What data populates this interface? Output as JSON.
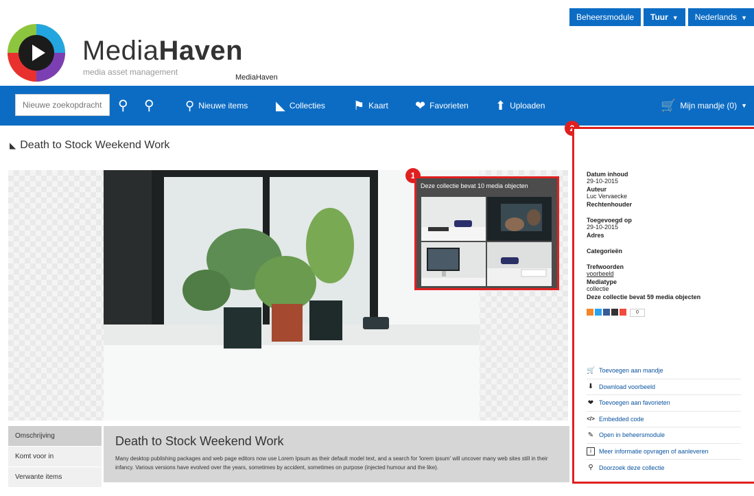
{
  "topbar": {
    "admin_label": "Beheersmodule",
    "user_label": "Tuur",
    "language_label": "Nederlands"
  },
  "brand": {
    "name_light": "Media",
    "name_bold": "Haven",
    "tagline": "media asset management",
    "site_name": "MediaHaven"
  },
  "nav": {
    "search_placeholder": "Nieuwe zoekopdracht",
    "items": [
      {
        "label": "Nieuwe items",
        "icon": "magnifier-icon"
      },
      {
        "label": "Collecties",
        "icon": "folder-icon"
      },
      {
        "label": "Kaart",
        "icon": "map-pin-icon"
      },
      {
        "label": "Favorieten",
        "icon": "heart-icon"
      },
      {
        "label": "Uploaden",
        "icon": "upload-icon"
      }
    ],
    "cart_label": "Mijn mandje (0)"
  },
  "page": {
    "title": "Death to Stock Weekend Work"
  },
  "preview": {
    "badge": "1",
    "title": "Deze collectie bevat 10 media objecten"
  },
  "sidebar": {
    "badge": "2",
    "fields": {
      "date_label": "Datum inhoud",
      "date_value": "29-10-2015",
      "author_label": "Auteur",
      "author_value": "Luc Vervaecke",
      "rights_label": "Rechtenhouder",
      "added_label": "Toegevoegd op",
      "added_value": "29-10-2015",
      "address_label": "Adres",
      "categories_label": "Categorieën",
      "keywords_label": "Trefwoorden",
      "keywords_value": "voorbeeld",
      "mediatype_label": "Mediatype",
      "mediatype_value": "collectie",
      "count_text": "Deze collectie bevat 59 media objecten"
    },
    "share_count": "0",
    "actions": [
      {
        "label": "Toevoegen aan mandje",
        "icon": "cart-icon"
      },
      {
        "label": "Download voorbeeld",
        "icon": "download-icon"
      },
      {
        "label": "Toevoegen aan favorieten",
        "icon": "heart-icon"
      },
      {
        "label": "Embedded code",
        "icon": "code-icon"
      },
      {
        "label": "Open in beheersmodule",
        "icon": "pencil-icon"
      },
      {
        "label": "Meer informatie opvragen of aanleveren",
        "icon": "info-icon"
      },
      {
        "label": "Doorzoek deze collectie",
        "icon": "search-icon"
      }
    ]
  },
  "tabs": [
    "Omschrijving",
    "Komt voor in",
    "Verwante items"
  ],
  "description": {
    "title": "Death to Stock Weekend Work",
    "text": "Many desktop publishing packages and web page editors now use Lorem Ipsum as their default model text, and a search for 'lorem ipsum' will uncover many web sites still in their infancy. Various versions have evolved over the years, sometimes by accident, sometimes on purpose (injected humour and the like)."
  },
  "colors": {
    "primary": "#0c6cc4",
    "highlight": "#e02020"
  }
}
